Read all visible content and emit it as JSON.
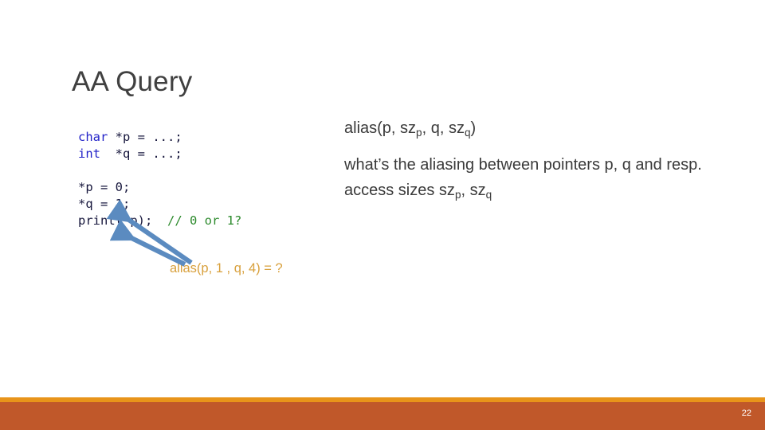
{
  "slide": {
    "title": "AA Query",
    "page_number": "22",
    "background_color": "#ffffff"
  },
  "code_block": {
    "lines": [
      {
        "keyword": "char",
        "rest": " *p = ...;"
      },
      {
        "keyword": "int ",
        "rest": " *q = ...;"
      },
      {
        "keyword": "",
        "rest": ""
      },
      {
        "keyword": "",
        "rest": "*p = 0;"
      },
      {
        "keyword": "",
        "rest": "*q = 1;"
      },
      {
        "keyword": "",
        "rest": "print(*p);",
        "comment": "// 0 or 1?"
      }
    ],
    "line1_keyword": "char",
    "line1_rest": " *p = ...;",
    "line2_keyword": "int ",
    "line2_rest": " *q = ...;",
    "line4_text": "*p = 0;",
    "line5_text": "*q = 1;",
    "line6_text": "print(*p);",
    "line6_comment": "// 0 or 1?",
    "keyword_color": "#2222c8",
    "comment_color": "#2e8b2e",
    "text_color": "#16163c"
  },
  "annotation": {
    "alias_query": "alias(p, 1 , q, 4) = ?",
    "color": "#d8a03c",
    "arrow_color": "#5b8bc0"
  },
  "right_column": {
    "signature_prefix": "alias(p, sz",
    "signature_sub1": "p",
    "signature_mid": ", q, sz",
    "signature_sub2": "q",
    "signature_suffix": ")",
    "description_part1": "what’s the aliasing between pointers p, q and resp. access sizes sz",
    "description_sub1": "p",
    "description_mid": ", sz",
    "description_sub2": "q"
  },
  "footer": {
    "thin_bar_color": "#e8941a",
    "thick_bar_color": "#c0582a"
  }
}
